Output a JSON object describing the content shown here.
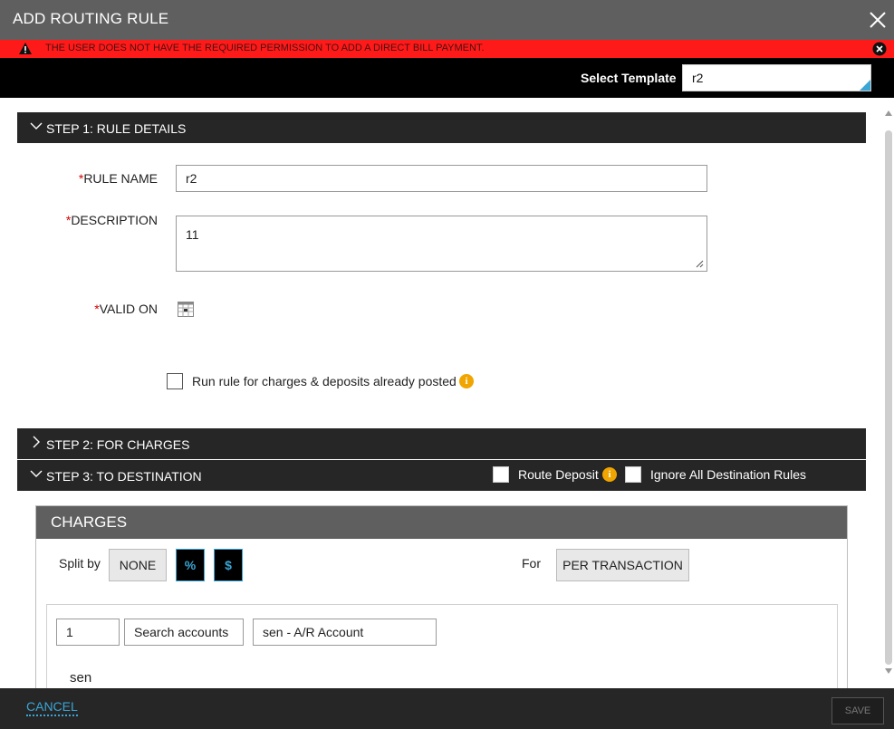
{
  "dialog": {
    "title": "ADD ROUTING RULE"
  },
  "error": {
    "message": "THE USER DOES NOT HAVE THE REQUIRED PERMISSION TO ADD A DIRECT BILL PAYMENT."
  },
  "template": {
    "label": "Select Template",
    "value": "r2"
  },
  "step1": {
    "label": "STEP 1:  RULE DETAILS",
    "rule_name_label": "RULE NAME",
    "rule_name_value": "r2",
    "description_label": "DESCRIPTION",
    "description_value": "11",
    "valid_on_label": "VALID ON",
    "required_mark": "*",
    "run_rule_label": "Run rule for charges & deposits already posted"
  },
  "step2": {
    "label": "STEP 2:  FOR CHARGES"
  },
  "step3": {
    "label": "STEP 3:  TO DESTINATION",
    "route_deposit_label": "Route Deposit",
    "ignore_rules_label": "Ignore All Destination Rules"
  },
  "charges": {
    "title": "CHARGES",
    "split_by_label": "Split by",
    "split_buttons": [
      "NONE",
      "%",
      "$"
    ],
    "for_label": "For",
    "for_value": "PER TRANSACTION",
    "row": {
      "qty": "1",
      "search_label": "Search accounts",
      "account": "sen - A/R Account",
      "selected_name": "sen"
    }
  },
  "footer": {
    "cancel": "CANCEL",
    "save": "SAVE"
  },
  "colors": {
    "accent": "#3aa6d6",
    "error": "#ff1a1a",
    "dark": "#262626",
    "header": "#5f5f5f",
    "warning": "#f0a500"
  }
}
